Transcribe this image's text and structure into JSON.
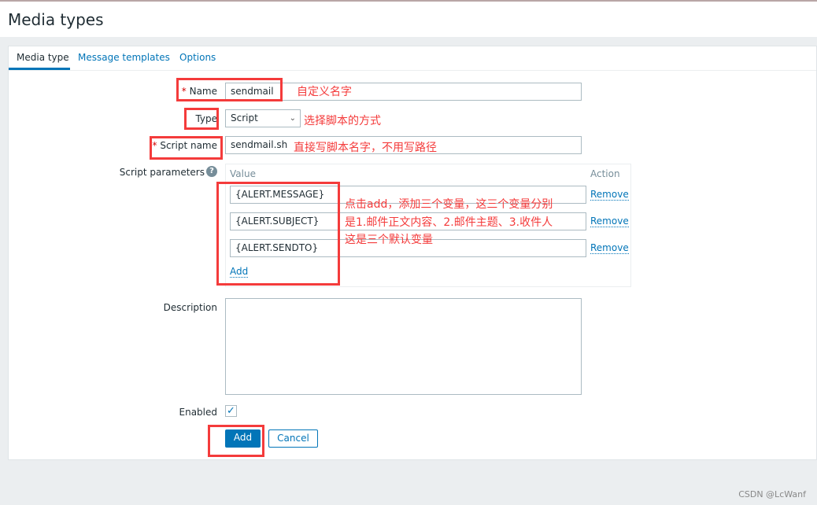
{
  "header": {
    "title": "Media types"
  },
  "tabs": [
    {
      "label": "Media type",
      "active": true
    },
    {
      "label": "Message templates"
    },
    {
      "label": "Options"
    }
  ],
  "form": {
    "name_label": "Name",
    "name_value": "sendmail",
    "type_label": "Type",
    "type_value": "Script",
    "script_name_label": "Script name",
    "script_name_value": "sendmail.sh",
    "params_label": "Script parameters",
    "params_header_value": "Value",
    "params_header_action": "Action",
    "params": [
      "{ALERT.MESSAGE}",
      "{ALERT.SUBJECT}",
      "{ALERT.SENDTO}"
    ],
    "remove_label": "Remove",
    "add_link": "Add",
    "description_label": "Description",
    "description_value": "",
    "enabled_label": "Enabled",
    "enabled": true,
    "add_button": "Add",
    "cancel_button": "Cancel"
  },
  "annotations": {
    "name": "自定义名字",
    "type": "选择脚本的方式",
    "script_name": "直接写脚本名字，不用写路径",
    "params_line1": "点击add，添加三个变量，这三个变量分别",
    "params_line2": "是1.邮件正文内容、2.邮件主题、3.收件人",
    "params_line3": "这是三个默认变量"
  },
  "watermark": "CSDN @LcWanf",
  "colors": {
    "accent": "#0275b8",
    "annotation": "#f43b3b",
    "required": "#d40000"
  }
}
